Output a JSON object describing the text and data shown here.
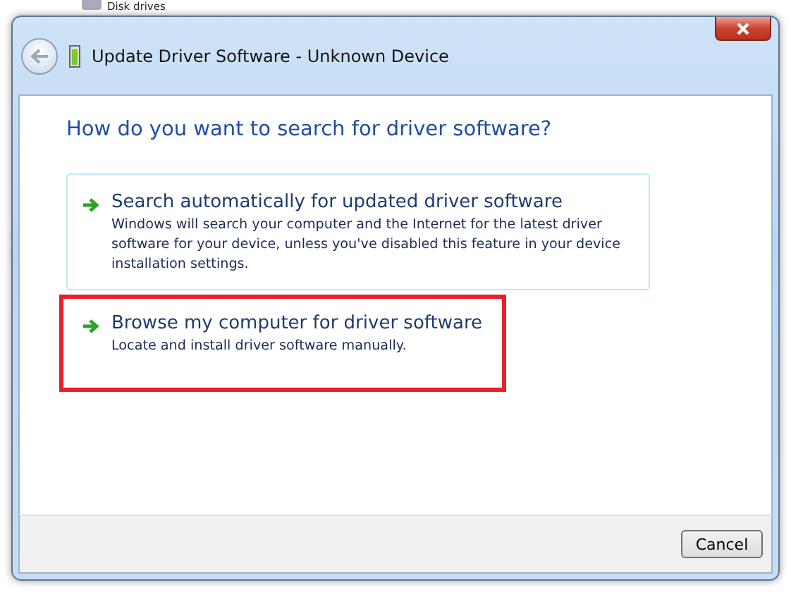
{
  "background_window": {
    "tree_item": "Disk drives"
  },
  "window": {
    "title": "Update Driver Software - Unknown Device"
  },
  "heading": "How do you want to search for driver software?",
  "options": [
    {
      "title": "Search automatically for updated driver software",
      "description": "Windows will search your computer and the Internet for the latest driver software for your device, unless you've disabled this feature in your device installation settings.",
      "hovered": true,
      "marked": false
    },
    {
      "title": "Browse my computer for driver software",
      "description": "Locate and install driver software manually.",
      "hovered": false,
      "marked": true
    }
  ],
  "buttons": [
    {
      "label": "Cancel"
    }
  ]
}
